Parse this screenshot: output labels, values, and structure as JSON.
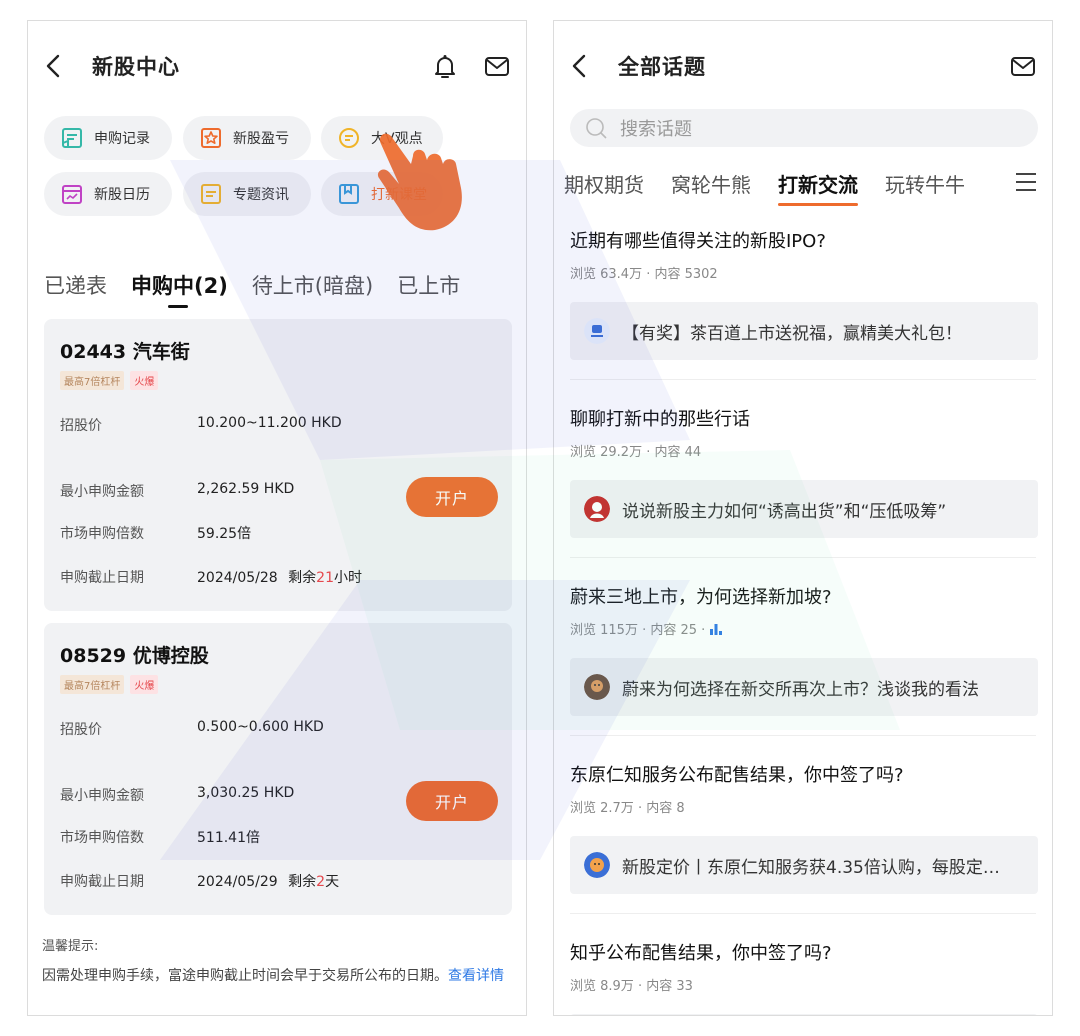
{
  "left": {
    "title": "新股中心",
    "quick": [
      {
        "label": "申购记录",
        "icon": "record-icon"
      },
      {
        "label": "新股盈亏",
        "icon": "star-icon"
      },
      {
        "label": "大V观点",
        "icon": "chat-icon"
      },
      {
        "label": "新股日历",
        "icon": "calendar-icon"
      },
      {
        "label": "专题资讯",
        "icon": "doc-icon"
      },
      {
        "label": "打新课堂",
        "icon": "bookmark-icon"
      }
    ],
    "tabs": [
      "已递表",
      "申购中(2)",
      "待上市(暗盘)",
      "已上市"
    ],
    "cards": [
      {
        "title": "02443  汽车街",
        "tag_leverage": "最高7倍杠杆",
        "tag_hot": "火爆",
        "price_label": "招股价",
        "price": "10.200~11.200 HKD",
        "min_label": "最小申购金额",
        "min": "2,262.59 HKD",
        "multiple_label": "市场申购倍数",
        "multiple": "59.25倍",
        "deadline_label": "申购截止日期",
        "deadline_date": "2024/05/28",
        "remain_prefix": "剩余",
        "remain_num": "21",
        "remain_unit": "小时",
        "button": "开户"
      },
      {
        "title": "08529  优博控股",
        "tag_leverage": "最高7倍杠杆",
        "tag_hot": "火爆",
        "price_label": "招股价",
        "price": "0.500~0.600 HKD",
        "min_label": "最小申购金额",
        "min": "3,030.25 HKD",
        "multiple_label": "市场申购倍数",
        "multiple": "511.41倍",
        "deadline_label": "申购截止日期",
        "deadline_date": "2024/05/29",
        "remain_prefix": "剩余",
        "remain_num": "2",
        "remain_unit": "天",
        "button": "开户"
      }
    ],
    "tip_title": "温馨提示:",
    "tip_body": "因需处理申购手续，富途申购截止时间会早于交易所公布的日期。",
    "tip_link": "查看详情"
  },
  "right": {
    "title": "全部话题",
    "search_placeholder": "搜索话题",
    "tabs": [
      "期权期货",
      "窝轮牛熊",
      "打新交流",
      "玩转牛牛"
    ],
    "topics": [
      {
        "title": "近期有哪些值得关注的新股IPO?",
        "meta": "浏览 63.4万 · 内容 5302",
        "post": "【有奖】茶百道上市送祝福，赢精美大礼包！"
      },
      {
        "title": "聊聊打新中的那些行话",
        "meta": "浏览 29.2万 · 内容 44",
        "post": "说说新股主力如何“诱高出货”和“压低吸筹”"
      },
      {
        "title": "蔚来三地上市，为何选择新加坡?",
        "meta": "浏览 115万 · 内容 25 ·",
        "post": "蔚来为何选择在新交所再次上市？浅谈我的看法"
      },
      {
        "title": "东原仁知服务公布配售结果，你中签了吗?",
        "meta": "浏览 2.7万 · 内容 8",
        "post": "新股定价丨东原仁知服务获4.35倍认购，每股定…"
      },
      {
        "title": "知乎公布配售结果，你中签了吗?",
        "meta": "浏览 8.9万 · 内容 33",
        "post": ""
      }
    ]
  },
  "colors": {
    "accent": "#ee6b2d",
    "hot": "#e5484d",
    "link": "#2f7ae5",
    "card_bg": "#f1f2f4"
  }
}
